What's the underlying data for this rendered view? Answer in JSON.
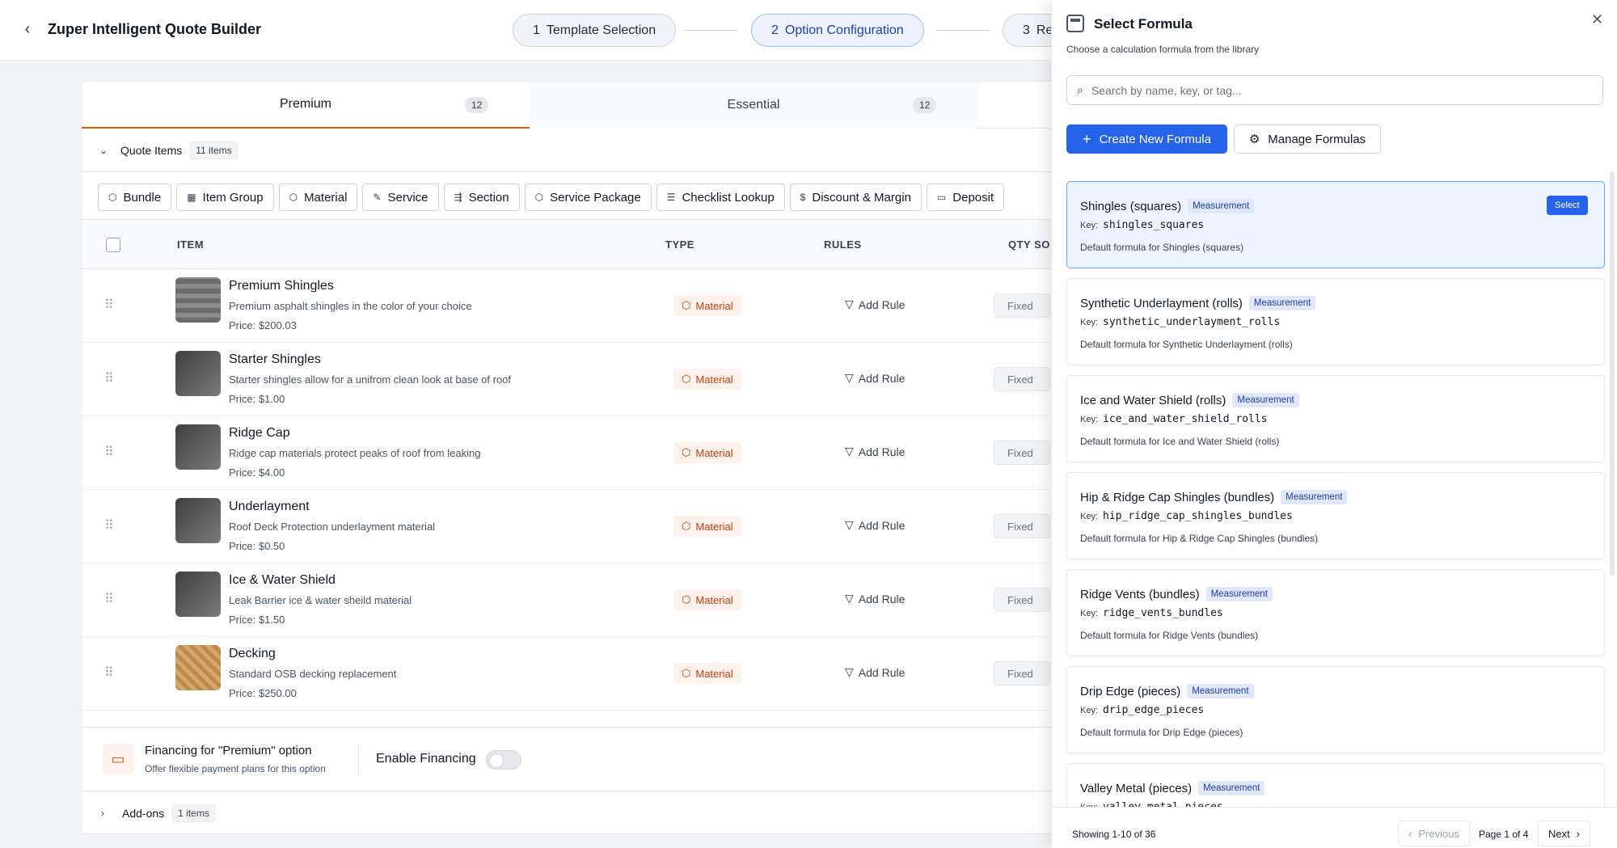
{
  "header": {
    "title": "Zuper Intelligent Quote Builder",
    "steps": [
      {
        "num": "1",
        "label": "Template Selection"
      },
      {
        "num": "2",
        "label": "Option Configuration"
      },
      {
        "num": "3",
        "label": "Re"
      }
    ]
  },
  "tabs": [
    {
      "label": "Premium",
      "count": "12"
    },
    {
      "label": "Essential",
      "count": "12"
    }
  ],
  "quote_items": {
    "title": "Quote Items",
    "count": "11 items"
  },
  "chips": [
    "Bundle",
    "Item Group",
    "Material",
    "Service",
    "Section",
    "Service Package",
    "Checklist Lookup",
    "Discount & Margin",
    "Deposit"
  ],
  "table": {
    "headers": {
      "item": "ITEM",
      "type": "TYPE",
      "rules": "RULES",
      "qty": "QTY SO"
    },
    "rows": [
      {
        "name": "Premium Shingles",
        "desc": "Premium asphalt shingles in the color of your choice",
        "price": "Price: $200.03",
        "type": "Material",
        "rule": "Add Rule",
        "qty": "Fixed"
      },
      {
        "name": "Starter Shingles",
        "desc": "Starter shingles allow for a unifrom clean look at base of roof",
        "price": "Price: $1.00",
        "type": "Material",
        "rule": "Add Rule",
        "qty": "Fixed"
      },
      {
        "name": "Ridge Cap",
        "desc": "Ridge cap materials protect peaks of roof from leaking",
        "price": "Price: $4.00",
        "type": "Material",
        "rule": "Add Rule",
        "qty": "Fixed"
      },
      {
        "name": "Underlayment",
        "desc": "Roof Deck Protection underlayment material",
        "price": "Price: $0.50",
        "type": "Material",
        "rule": "Add Rule",
        "qty": "Fixed"
      },
      {
        "name": "Ice & Water Shield",
        "desc": "Leak Barrier ice & water sheild material",
        "price": "Price: $1.50",
        "type": "Material",
        "rule": "Add Rule",
        "qty": "Fixed"
      },
      {
        "name": "Decking",
        "desc": "Standard OSB decking replacement",
        "price": "Price: $250.00",
        "type": "Material",
        "rule": "Add Rule",
        "qty": "Fixed"
      }
    ]
  },
  "financing": {
    "title": "Financing for \"Premium\" option",
    "subtitle": "Offer flexible payment plans for this option",
    "enable_label": "Enable Financing"
  },
  "addons": {
    "title": "Add-ons",
    "count": "1 items"
  },
  "drawer": {
    "title": "Select Formula",
    "subtitle": "Choose a calculation formula from the library",
    "search_placeholder": "Search by name, key, or tag...",
    "create_label": "Create New Formula",
    "manage_label": "Manage Formulas",
    "key_label": "Key:",
    "select_label": "Select",
    "formulas": [
      {
        "name": "Shingles (squares)",
        "tag": "Measurement",
        "key": "shingles_squares",
        "desc": "Default formula for Shingles (squares)"
      },
      {
        "name": "Synthetic Underlayment (rolls)",
        "tag": "Measurement",
        "key": "synthetic_underlayment_rolls",
        "desc": "Default formula for Synthetic Underlayment (rolls)"
      },
      {
        "name": "Ice and Water Shield (rolls)",
        "tag": "Measurement",
        "key": "ice_and_water_shield_rolls",
        "desc": "Default formula for Ice and Water Shield (rolls)"
      },
      {
        "name": "Hip & Ridge Cap Shingles (bundles)",
        "tag": "Measurement",
        "key": "hip_ridge_cap_shingles_bundles",
        "desc": "Default formula for Hip & Ridge Cap Shingles (bundles)"
      },
      {
        "name": "Ridge Vents (bundles)",
        "tag": "Measurement",
        "key": "ridge_vents_bundles",
        "desc": "Default formula for Ridge Vents (bundles)"
      },
      {
        "name": "Drip Edge (pieces)",
        "tag": "Measurement",
        "key": "drip_edge_pieces",
        "desc": "Default formula for Drip Edge (pieces)"
      },
      {
        "name": "Valley Metal (pieces)",
        "tag": "Measurement",
        "key": "valley_metal_pieces",
        "desc": ""
      }
    ],
    "footer": {
      "showing": "Showing 1-10 of 36",
      "previous": "Previous",
      "page_info": "Page 1 of 4",
      "next": "Next"
    }
  },
  "colors": {
    "primary": "#2563eb",
    "accent": "#ea580c",
    "material_badge_bg": "#fff1ec"
  },
  "icons": [
    "back-chevron-icon",
    "cube-icon",
    "grid-icon",
    "wrench-icon",
    "section-icon",
    "checklist-icon",
    "dollar-icon",
    "deposit-icon",
    "drag-handle-icon",
    "filter-icon",
    "credit-card-icon",
    "calculator-icon",
    "search-icon",
    "plus-icon",
    "gear-icon",
    "close-icon",
    "chevron-right-icon",
    "chevron-left-icon"
  ]
}
